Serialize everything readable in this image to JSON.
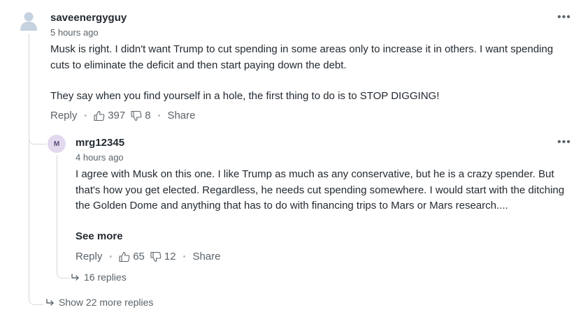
{
  "comment": {
    "username": "saveenergyguy",
    "timestamp": "5 hours ago",
    "paragraphs": [
      "Musk is right. I didn't want Trump to cut spending in some areas only to increase it in others. I want spending cuts to eliminate the deficit and then start paying down the debt.",
      "They say when you find yourself in a hole, the first thing to do is to STOP DIGGING!"
    ],
    "reply_label": "Reply",
    "likes": "397",
    "dislikes": "8",
    "share_label": "Share",
    "more_menu": "•••",
    "avatar_icon": "generic-user-icon"
  },
  "reply": {
    "username": "mrg12345",
    "avatar_letter": "M",
    "timestamp": "4 hours ago",
    "text": "I agree with Musk on this one. I like Trump as much as any conservative, but he is a crazy spender. But that's how you get elected. Regardless, he needs cut spending somewhere. I would start with the ditching the Golden Dome and anything that has to do with financing trips to Mars or Mars research....",
    "see_more": "See more",
    "reply_label": "Reply",
    "likes": "65",
    "dislikes": "12",
    "share_label": "Share",
    "more_menu": "•••",
    "replies_link": "16 replies"
  },
  "show_more_replies": "Show 22 more replies",
  "separator": "•",
  "colors": {
    "text": "#232a31",
    "muted": "#5b636a",
    "thread_line": "#d5d8dc",
    "avatar_bg": "#e2d9ee",
    "generic_avatar": "#c5d2e0"
  }
}
